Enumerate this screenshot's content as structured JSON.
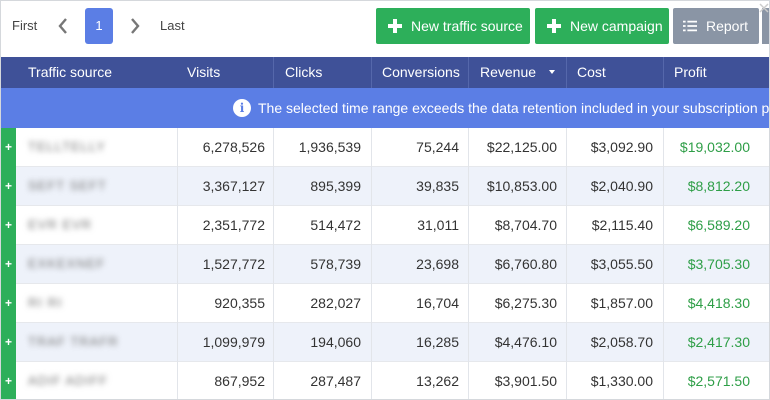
{
  "pagination": {
    "first_label": "First",
    "current_page": "1",
    "last_label": "Last",
    "prev_icon": "chevron-left-icon",
    "next_icon": "chevron-right-icon"
  },
  "toolbar": {
    "new_traffic_source_label": "New traffic source",
    "new_campaign_label": "New campaign",
    "report_label": "Report",
    "primary_color": "#2daf5a",
    "report_color": "#8a95a5"
  },
  "table": {
    "headers": [
      "Traffic source",
      "Visits",
      "Clicks",
      "Conversions",
      "Revenue",
      "Cost",
      "Profit"
    ],
    "sorted_column": "Revenue",
    "header_color": "#3f5198",
    "rows": [
      {
        "name": "TELLTELLY",
        "visits": "6,278,526",
        "clicks": "1,936,539",
        "conversions": "75,244",
        "revenue": "$22,125.00",
        "cost": "$3,092.90",
        "profit": "$19,032.00"
      },
      {
        "name": "SEFT SEFT",
        "visits": "3,367,127",
        "clicks": "895,399",
        "conversions": "39,835",
        "revenue": "$10,853.00",
        "cost": "$2,040.90",
        "profit": "$8,812.20"
      },
      {
        "name": "EVR EVR",
        "visits": "2,351,772",
        "clicks": "514,472",
        "conversions": "31,011",
        "revenue": "$8,704.70",
        "cost": "$2,115.40",
        "profit": "$6,589.20"
      },
      {
        "name": "EXKEXNEF",
        "visits": "1,527,772",
        "clicks": "578,739",
        "conversions": "23,698",
        "revenue": "$6,760.80",
        "cost": "$3,055.50",
        "profit": "$3,705.30"
      },
      {
        "name": "RI    RI",
        "visits": "920,355",
        "clicks": "282,027",
        "conversions": "16,704",
        "revenue": "$6,275.30",
        "cost": "$1,857.00",
        "profit": "$4,418.30"
      },
      {
        "name": "TRAF TRAFR",
        "visits": "1,099,979",
        "clicks": "194,060",
        "conversions": "16,285",
        "revenue": "$4,476.10",
        "cost": "$2,058.70",
        "profit": "$2,417.30"
      },
      {
        "name": "ADIF ADIFF",
        "visits": "867,952",
        "clicks": "287,487",
        "conversions": "13,262",
        "revenue": "$3,901.50",
        "cost": "$1,330.00",
        "profit": "$2,571.50"
      }
    ]
  },
  "banner": {
    "text": "The selected time range exceeds the data retention included in your subscription pla",
    "color": "#5b7ee5",
    "icon": "info-icon"
  },
  "expander_label": "+"
}
